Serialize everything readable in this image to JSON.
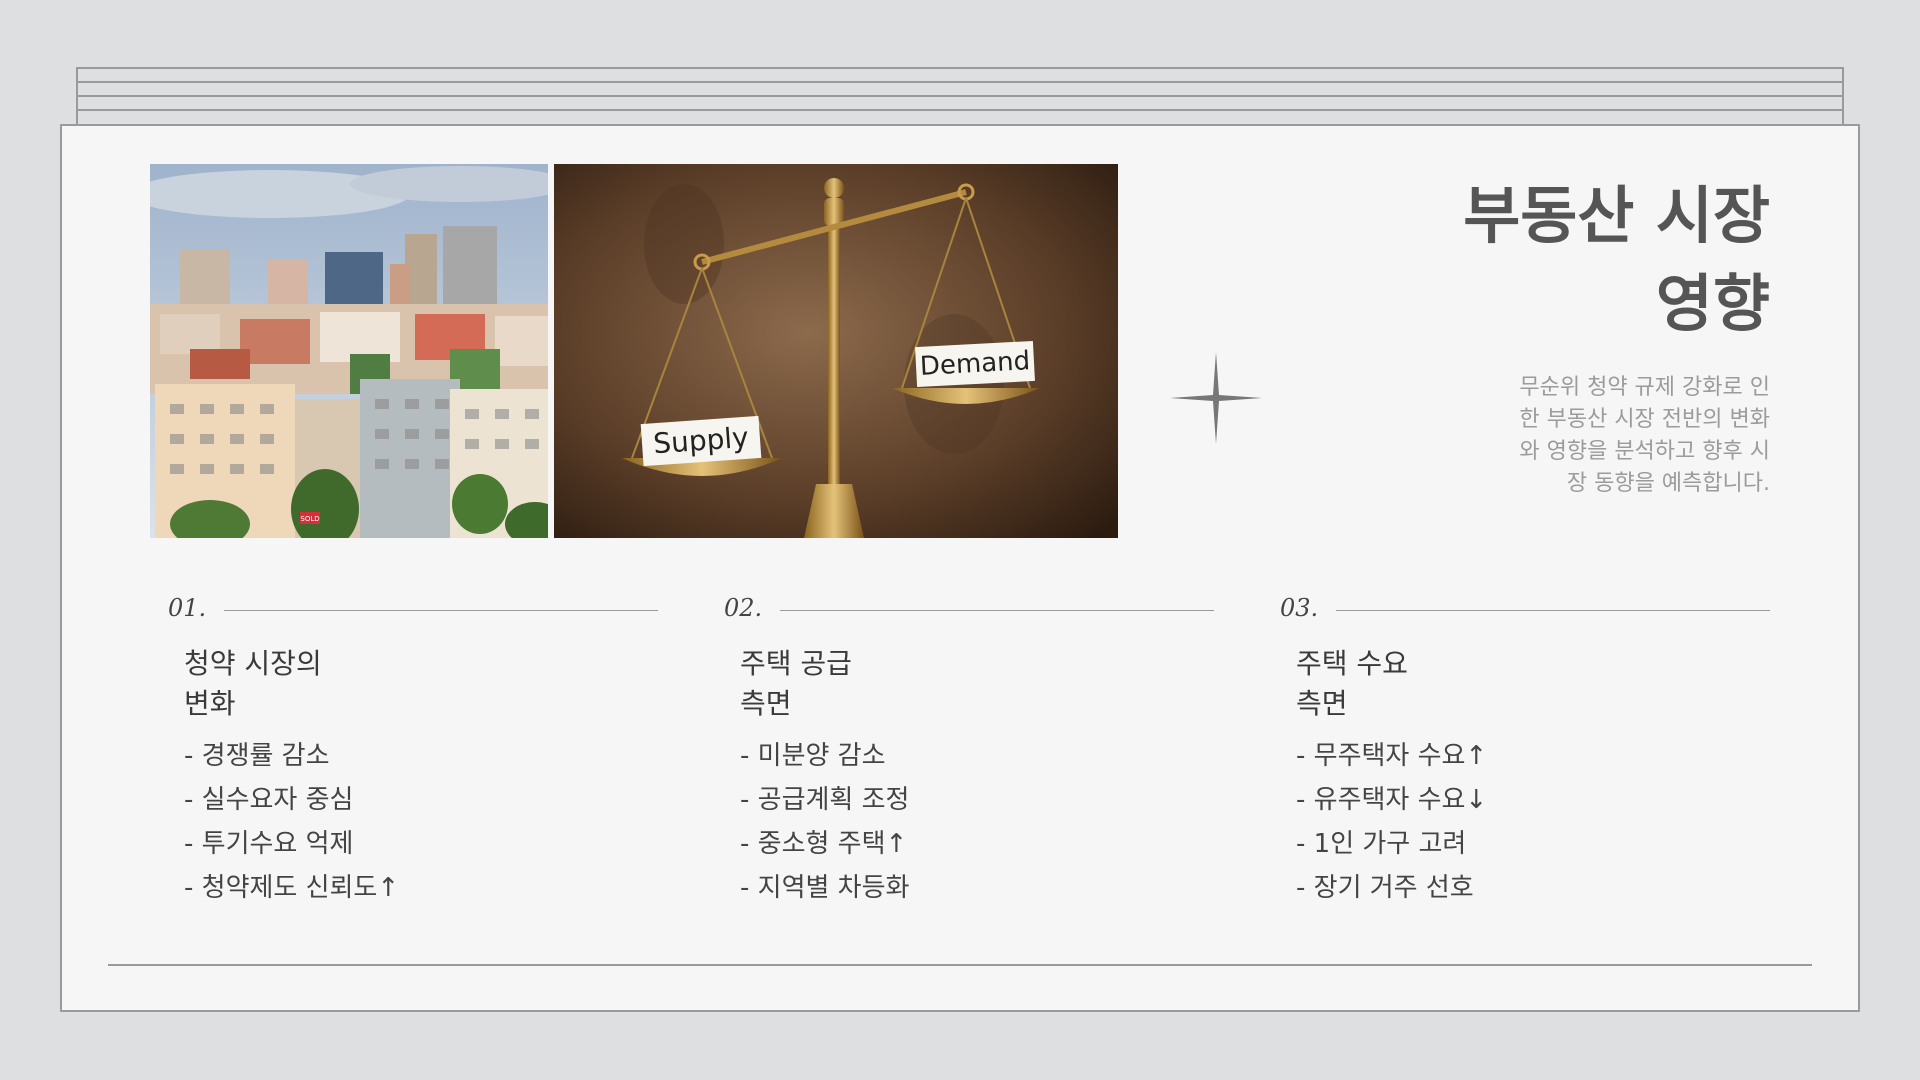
{
  "slide": {
    "title_line1": "부동산 시장",
    "title_line2": "영향",
    "subtitle": "무순위 청약 규제 강화로 인한 부동산 시장 전반의 변화와 영향을 분석하고 향후 시장 동향을 예측합니다.",
    "images": {
      "city": "apartment-cityscape-photo",
      "scale": "balance-scale-photo",
      "scale_left_card": "Supply",
      "scale_right_card": "Demand",
      "sign": "SOLD"
    },
    "accent_line_color": "#9a9a9a",
    "columns": [
      {
        "number": "01.",
        "heading_line1": "청약 시장의",
        "heading_line2": "변화",
        "items": [
          "- 경쟁률 감소",
          "- 실수요자 중심",
          "- 투기수요 억제",
          "- 청약제도 신뢰도↑"
        ]
      },
      {
        "number": "02.",
        "heading_line1": "주택 공급",
        "heading_line2": "측면",
        "items": [
          "- 미분양 감소",
          "- 공급계획 조정",
          "- 중소형 주택↑",
          "- 지역별 차등화"
        ]
      },
      {
        "number": "03.",
        "heading_line1": "주택 수요",
        "heading_line2": "측면",
        "items": [
          "- 무주택자 수요↑",
          "- 유주택자 수요↓",
          "- 1인 가구 고려",
          "- 장기 거주 선호"
        ]
      }
    ]
  }
}
